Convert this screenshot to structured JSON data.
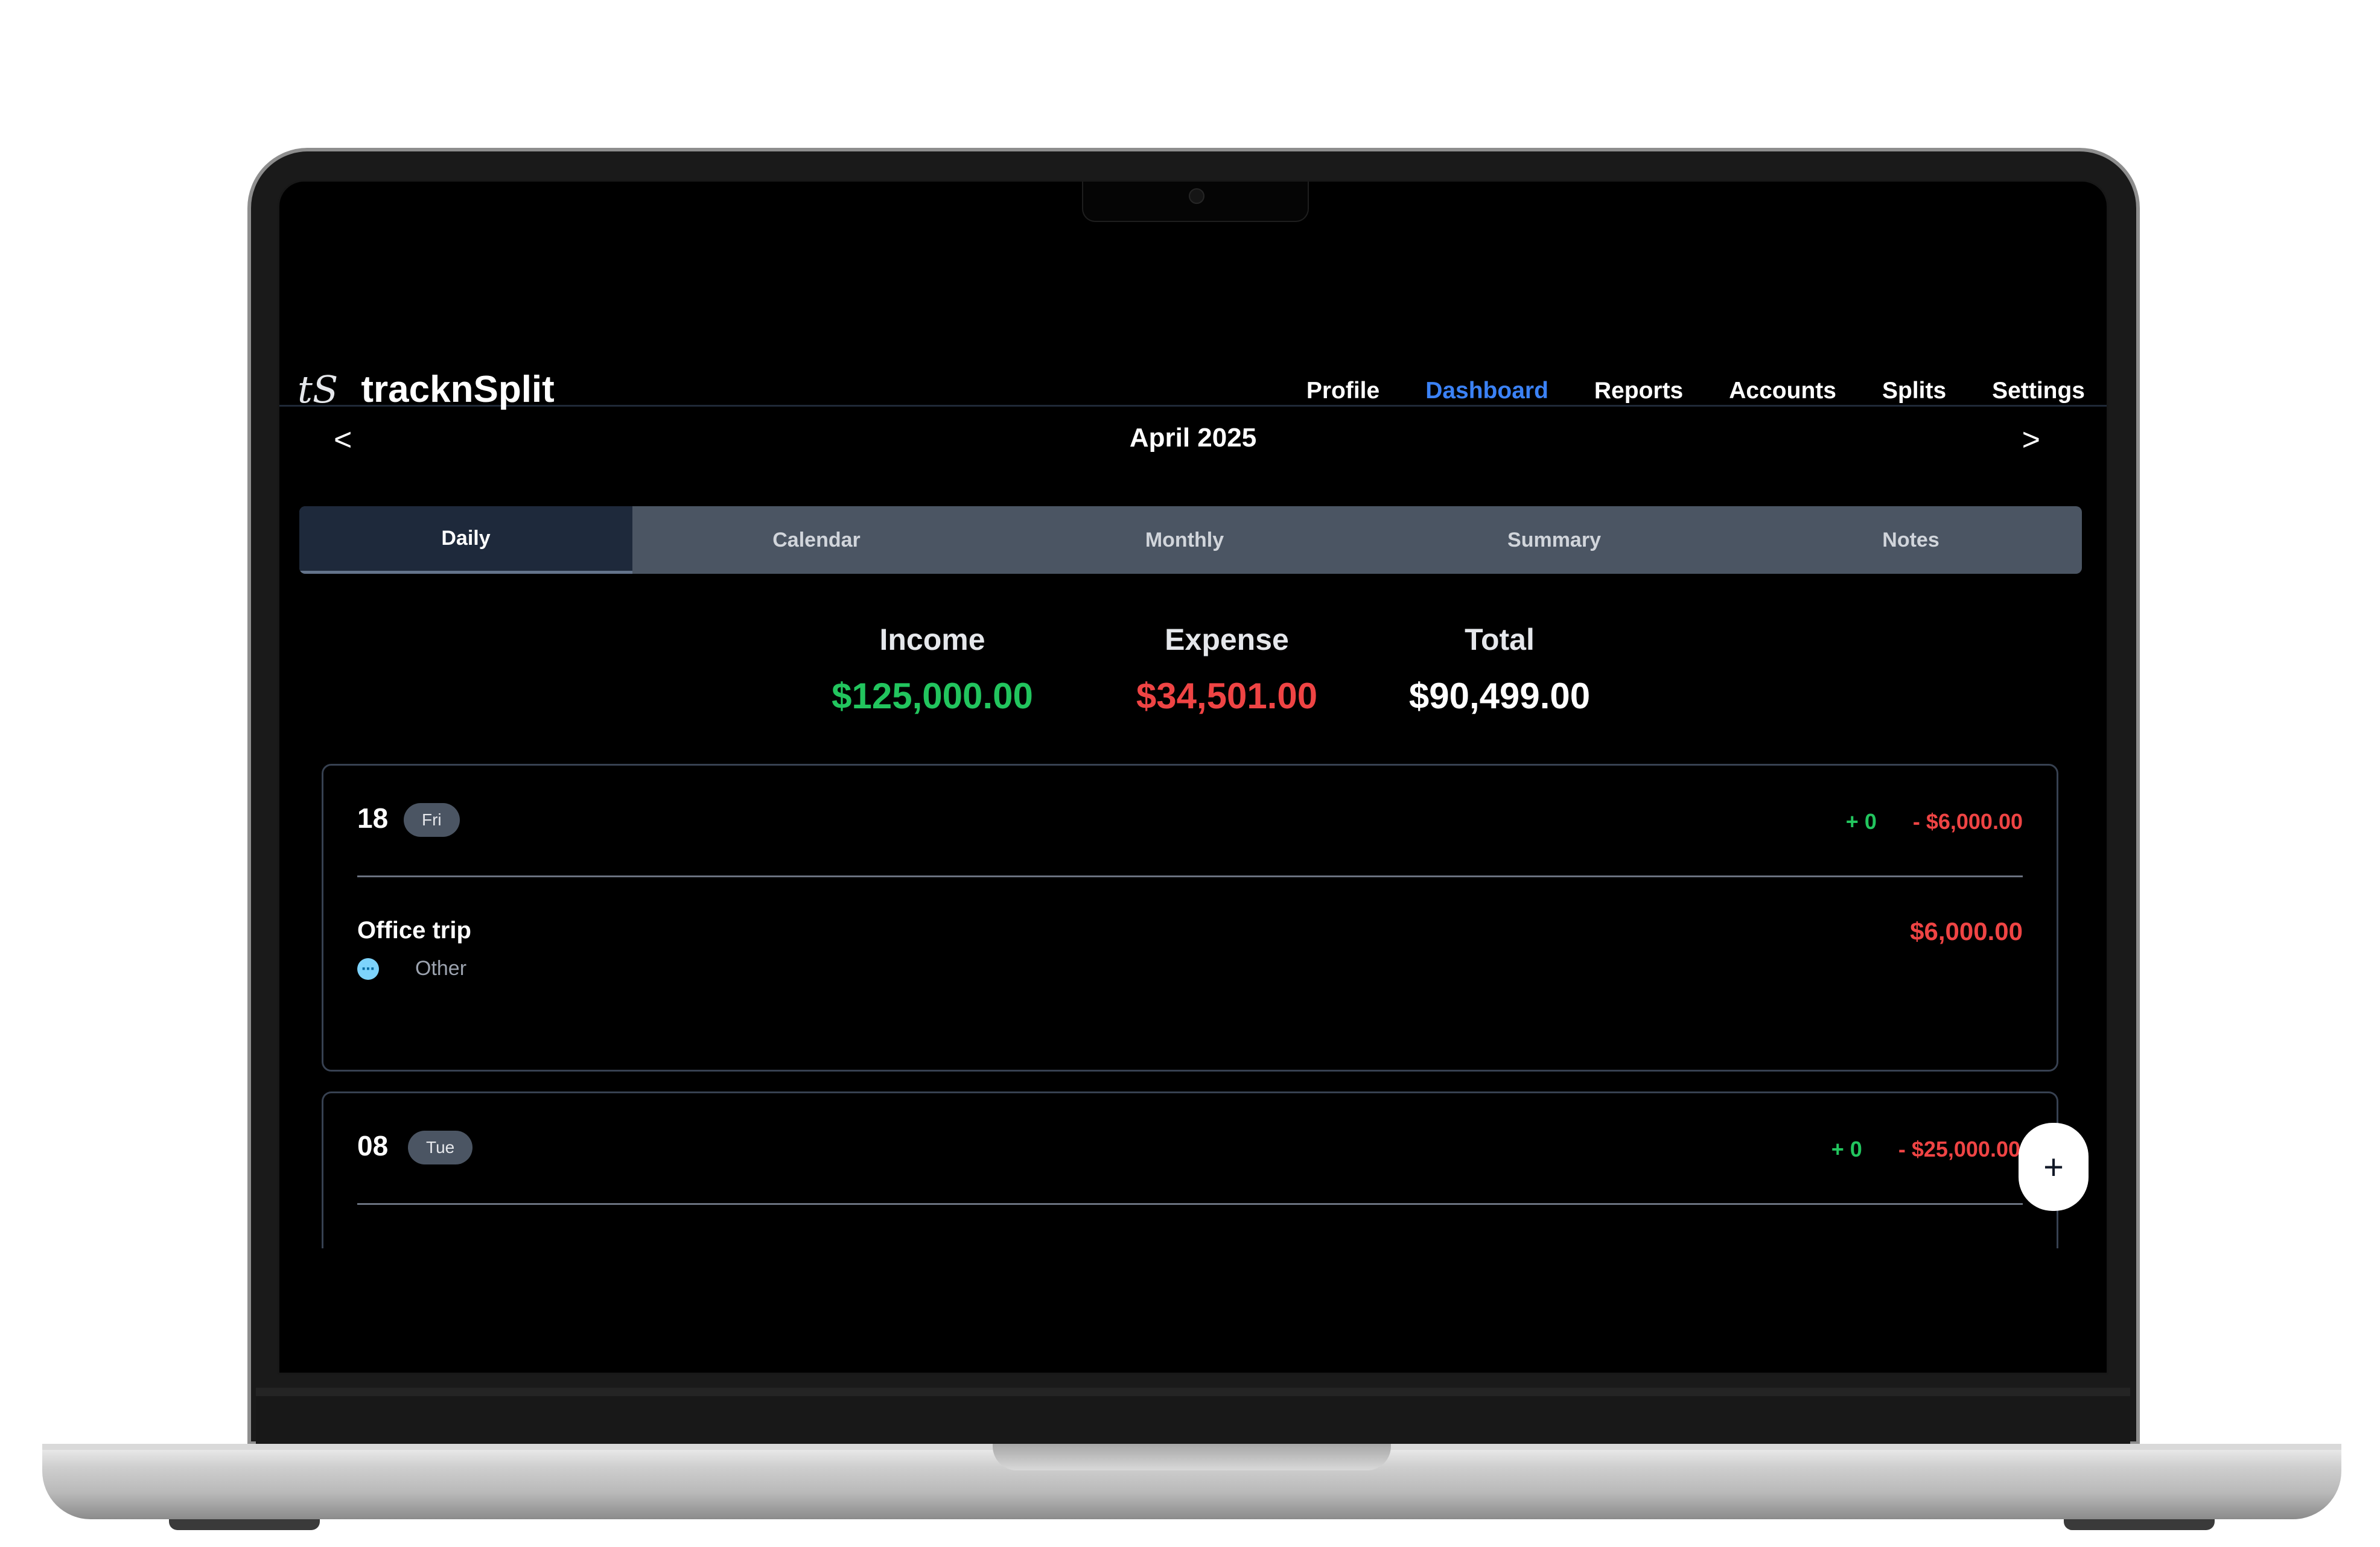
{
  "app": {
    "logo_mark": "tS",
    "name": "tracknSplit"
  },
  "nav": {
    "items": [
      {
        "label": "Profile",
        "active": false
      },
      {
        "label": "Dashboard",
        "active": true
      },
      {
        "label": "Reports",
        "active": false
      },
      {
        "label": "Accounts",
        "active": false
      },
      {
        "label": "Splits",
        "active": false
      },
      {
        "label": "Settings",
        "active": false
      }
    ],
    "active_color": "#3b82f6"
  },
  "period": {
    "prev": "<",
    "label": "April 2025",
    "next": ">"
  },
  "tabs": [
    {
      "label": "Daily",
      "active": true
    },
    {
      "label": "Calendar",
      "active": false
    },
    {
      "label": "Monthly",
      "active": false
    },
    {
      "label": "Summary",
      "active": false
    },
    {
      "label": "Notes",
      "active": false
    }
  ],
  "totals": {
    "income_label": "Income",
    "income_value": "$125,000.00",
    "expense_label": "Expense",
    "expense_value": "$34,501.00",
    "total_label": "Total",
    "total_value": "$90,499.00"
  },
  "days": [
    {
      "day": "18",
      "weekday": "Fri",
      "income": "+ 0",
      "expense": "- $6,000.00",
      "transactions": [
        {
          "title": "Office trip",
          "category": "Other",
          "category_icon": "chat-bubble-icon",
          "amount": "$6,000.00"
        }
      ]
    },
    {
      "day": "08",
      "weekday": "Tue",
      "income": "+ 0",
      "expense": "- $25,000.00",
      "transactions": []
    }
  ],
  "fab": {
    "label": "+"
  },
  "colors": {
    "income": "#22c55e",
    "expense": "#ef4444",
    "background": "#000000"
  }
}
